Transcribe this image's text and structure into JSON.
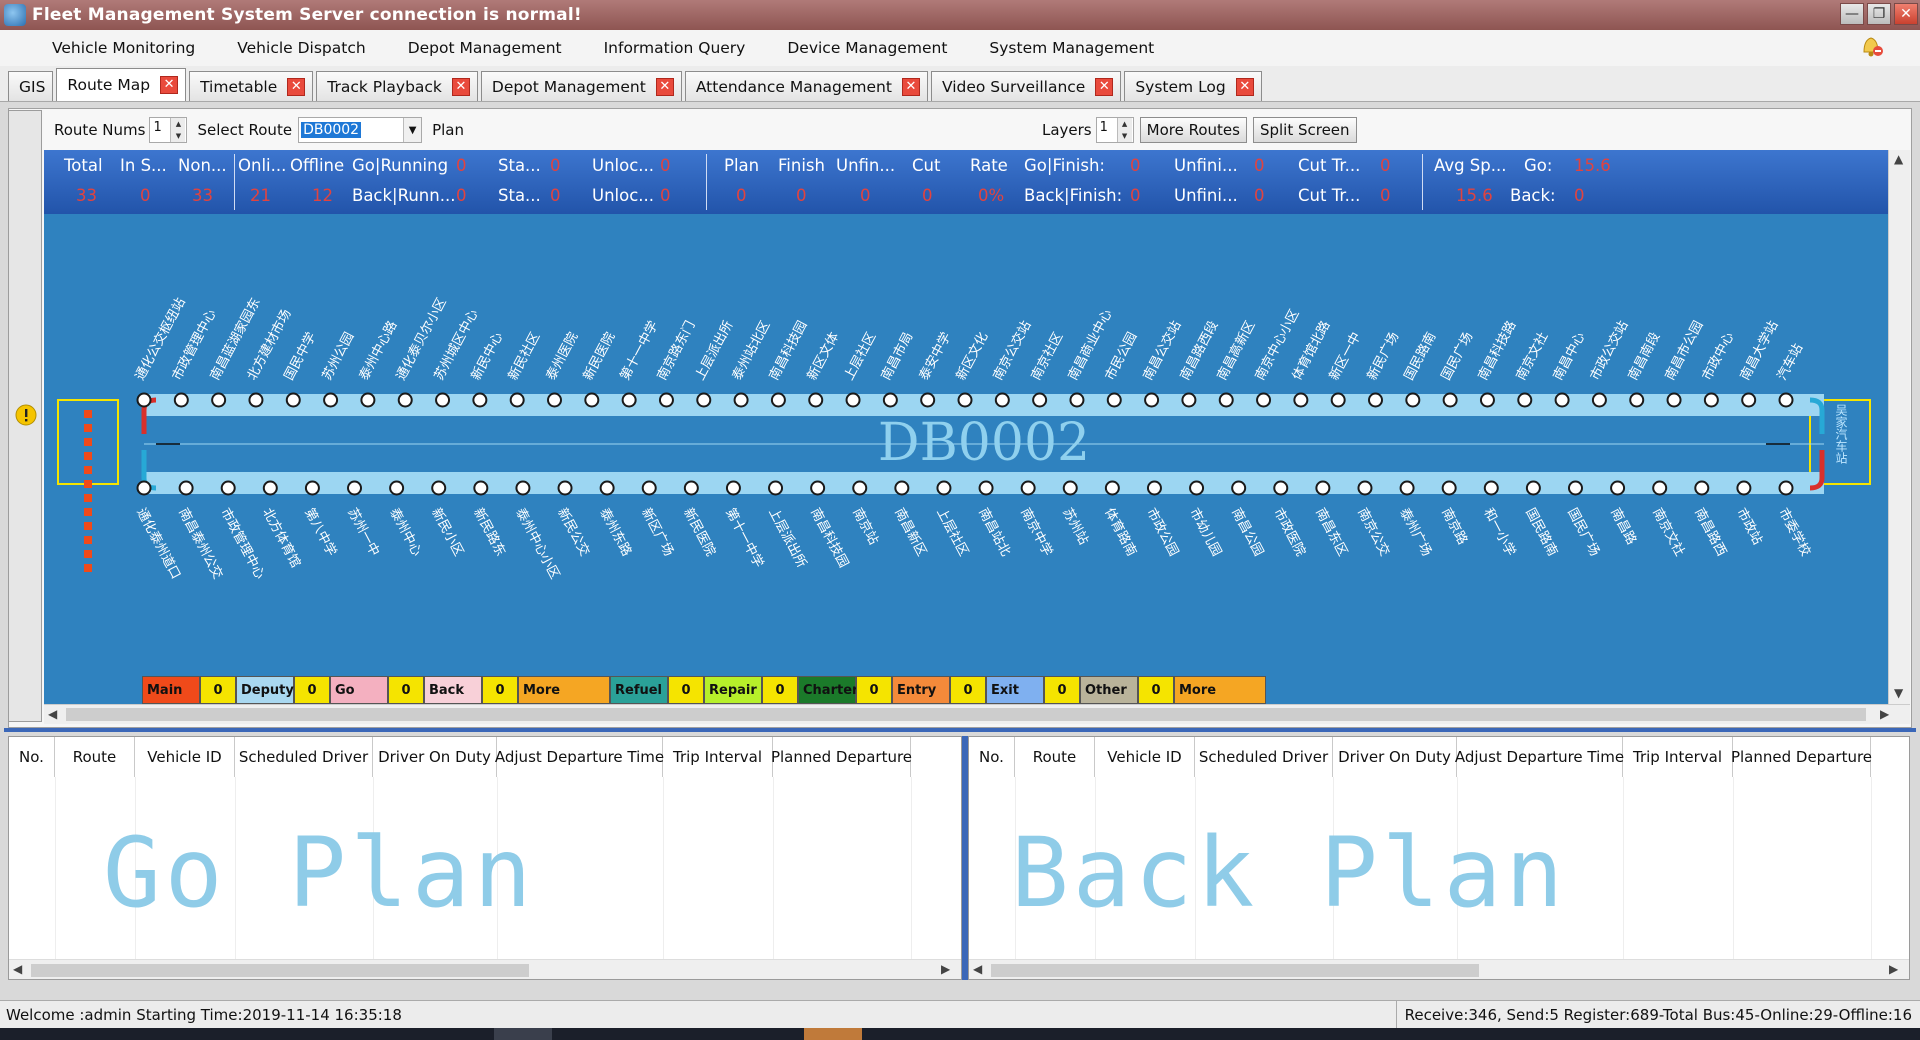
{
  "window": {
    "title": "Fleet Management System Server connection is normal!"
  },
  "menu": [
    "Vehicle Monitoring",
    "Vehicle Dispatch",
    "Depot Management",
    "Information Query",
    "Device Management",
    "System Management"
  ],
  "tabs": [
    {
      "label": "GIS",
      "closable": false,
      "active": false
    },
    {
      "label": "Route Map",
      "closable": true,
      "active": true
    },
    {
      "label": "Timetable",
      "closable": true,
      "active": false
    },
    {
      "label": "Track Playback",
      "closable": true,
      "active": false
    },
    {
      "label": "Depot Management",
      "closable": true,
      "active": false
    },
    {
      "label": "Attendance Management",
      "closable": true,
      "active": false
    },
    {
      "label": "Video Surveillance",
      "closable": true,
      "active": false
    },
    {
      "label": "System Log",
      "closable": true,
      "active": false
    }
  ],
  "toolbar": {
    "route_nums_label": "Route Nums",
    "route_nums_value": "1",
    "select_route_label": "Select Route",
    "select_route_value": "DB0002",
    "plan_label": "Plan",
    "layers_label": "Layers",
    "layers_value": "1",
    "more_routes": "More Routes",
    "split_screen": "Split Screen"
  },
  "stats": {
    "total": {
      "label": "Total",
      "value": "33"
    },
    "in_service": {
      "label": "In S...",
      "value": "0"
    },
    "non_service": {
      "label": "Non...",
      "value": "33"
    },
    "online": {
      "label": "Onli...",
      "value": "21"
    },
    "offline": {
      "label": "Offline",
      "value": "12"
    },
    "go_running": {
      "label": "Go|Running",
      "value": "0"
    },
    "back_running": {
      "label": "Back|Runn...",
      "value": "0"
    },
    "sta1": {
      "label": "Sta...",
      "value": "0"
    },
    "sta2": {
      "label": "Sta...",
      "value": "0"
    },
    "unloc1": {
      "label": "Unloc...",
      "value": "0"
    },
    "unloc2": {
      "label": "Unloc...",
      "value": "0"
    },
    "plan": {
      "label": "Plan",
      "value": "0"
    },
    "finish": {
      "label": "Finish",
      "value": "0"
    },
    "unfinished": {
      "label": "Unfin...",
      "value": "0"
    },
    "cut": {
      "label": "Cut",
      "value": "0"
    },
    "rate": {
      "label": "Rate",
      "value": "0%"
    },
    "go_finish": {
      "label": "Go|Finish:",
      "value": "0"
    },
    "back_finish": {
      "label": "Back|Finish:",
      "value": "0"
    },
    "unfini1": {
      "label": "Unfini...",
      "value": "0"
    },
    "unfini2": {
      "label": "Unfini...",
      "value": "0"
    },
    "cut_tr1": {
      "label": "Cut Tr...",
      "value": "0"
    },
    "cut_tr2": {
      "label": "Cut Tr...",
      "value": "0"
    },
    "avg_speed": {
      "label": "Avg Sp...",
      "value": "15.6"
    },
    "go_speed": {
      "label": "Go:",
      "value": "15.6"
    },
    "back_speed": {
      "label": "Back:",
      "value": "0"
    }
  },
  "map": {
    "route_name": "DB0002",
    "end_terminal": "吴家汽车站",
    "top_stations": [
      "通化公交枢纽站",
      "市政管理中心",
      "南昌蓝湖家园东",
      "北方建材市场",
      "国民中学",
      "苏州公园",
      "泰州中心路",
      "通化泰贝尔小区",
      "苏州城区中心",
      "新民中心",
      "新民社区",
      "泰州医院",
      "新民医院",
      "第十一中学",
      "南京路东门",
      "上层派出所",
      "泰州站北区",
      "南昌科技园",
      "新区文体",
      "上层社区",
      "南昌市局",
      "泰安中学",
      "新区文化",
      "南京公交站",
      "南京社区",
      "南昌商业中心",
      "市民公园",
      "南昌公交站",
      "南昌路西段",
      "南昌高新区",
      "南京中心小区",
      "体育馆北路",
      "新区一中",
      "新民广场",
      "国民路南",
      "国民广场",
      "南昌科技路",
      "南京文社",
      "南昌中心",
      "市政公交站",
      "南昌南段",
      "南昌市公园",
      "市政中心",
      "南昌大学站",
      "汽车站"
    ],
    "bottom_stations": [
      "通化泰州道口",
      "南昌泰州公交",
      "市政管理中心",
      "北方体育馆",
      "第八中学",
      "苏州一中",
      "泰州中心",
      "新民小区",
      "新民路东",
      "泰州中心小区",
      "新民公交",
      "泰州东路",
      "新区广场",
      "新民医院",
      "第十一中学",
      "上层派出所",
      "南昌科技园",
      "南京站",
      "南昌新区",
      "上层社区",
      "南昌站北",
      "南京中学",
      "苏州站",
      "体育路南",
      "市政公园",
      "市幼儿园",
      "南昌公园",
      "市政医院",
      "南昌东区",
      "南京公交",
      "泰州广场",
      "南京路",
      "和一小学",
      "国民路南",
      "国民广场",
      "南昌路",
      "南京文社",
      "南昌路西",
      "市政站",
      "市委学校"
    ],
    "station_count_top": 45,
    "station_count_bottom": 40
  },
  "legend": [
    {
      "label": "Main",
      "value": "0",
      "color": "#f04a1a"
    },
    {
      "label": "Deputy",
      "value": "0",
      "color": "#a9d8f0"
    },
    {
      "label": "Go",
      "value": "0",
      "color": "#f4b0c0"
    },
    {
      "label": "Back",
      "value": "0",
      "color": "#f8d0d8"
    },
    {
      "label": "More",
      "value": "",
      "color": "#f5a623"
    },
    {
      "label": "Refuel",
      "value": "0",
      "color": "#2aa198"
    },
    {
      "label": "Repair",
      "value": "0",
      "color": "#b7f02a"
    },
    {
      "label": "Charter",
      "value": "0",
      "color": "#1b7a2a"
    },
    {
      "label": "Entry",
      "value": "0",
      "color": "#f48a3a"
    },
    {
      "label": "Exit",
      "value": "0",
      "color": "#7fb0f0"
    },
    {
      "label": "Other",
      "value": "0",
      "color": "#b9b39a"
    },
    {
      "label": "More",
      "value": "",
      "color": "#f5a623"
    }
  ],
  "plans": {
    "columns": [
      "No.",
      "Route",
      "Vehicle ID",
      "Scheduled Driver",
      "Driver On Duty",
      "Adjust Departure Time",
      "Trip Interval",
      "Planned Departure"
    ],
    "go_title": "Go Plan",
    "back_title": "Back Plan"
  },
  "status": {
    "welcome": "Welcome :admin  Starting Time:2019-11-14 16:35:18",
    "right": "Receive:346, Send:5  Register:689-Total Bus:45-Online:29-Offline:16"
  }
}
